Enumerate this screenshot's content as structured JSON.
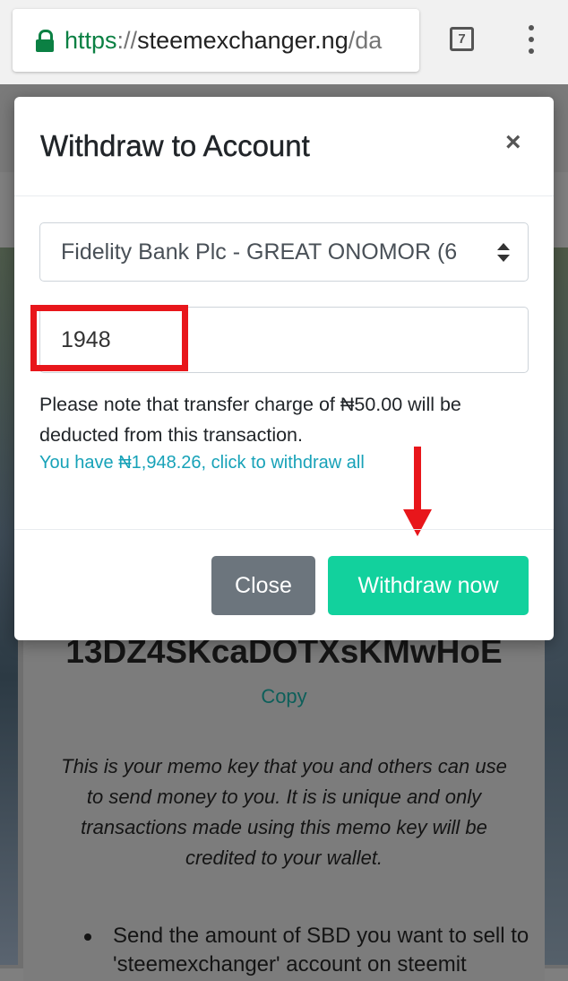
{
  "browser": {
    "url_scheme": "https",
    "url_separator": "://",
    "url_host": "steemexchanger.ng",
    "url_path": "/da",
    "tab_count": "7"
  },
  "background_page": {
    "memo_key": "13DZ4SKcaDOTXsKMwHoE",
    "copy_label": "Copy",
    "memo_note": "This is your memo key that you and others can use to send money to you. It is is unique and only transactions made using this memo key will be credited to your wallet.",
    "bullet_text": "Send the amount of SBD you want to sell to 'steemexchanger' account on steemit"
  },
  "modal": {
    "title": "Withdraw to Account",
    "close_symbol": "×",
    "bank_select_value": "Fidelity Bank Plc - GREAT ONOMOR (6",
    "amount_value": "1948",
    "charge_note": "Please note that transfer charge of ₦50.00 will be deducted from this transaction.",
    "withdraw_all_link": "You have ₦1,948.26, click to withdraw all",
    "close_button": "Close",
    "withdraw_button": "Withdraw now"
  },
  "colors": {
    "accent_teal": "#17a2b8",
    "withdraw_button": "#12d19d",
    "close_button": "#6c757d",
    "annotation_red": "#e8161b",
    "lock_green": "#0b8043"
  },
  "icons": [
    "lock-icon",
    "tabs-icon",
    "menu-dots-icon",
    "close-icon",
    "select-arrows-icon",
    "arrow-down-annotation"
  ]
}
